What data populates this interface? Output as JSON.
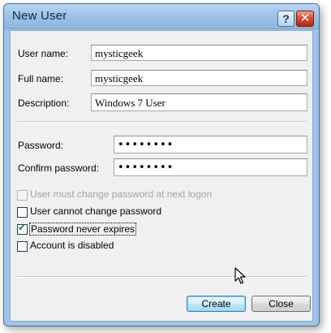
{
  "window": {
    "title": "New User",
    "help_glyph": "?",
    "close_glyph": "✕"
  },
  "fields": {
    "user_name": {
      "label": "User name:",
      "value": "mysticgeek"
    },
    "full_name": {
      "label": "Full name:",
      "value": "mysticgeek"
    },
    "description": {
      "label": "Description:",
      "value": "Windows 7 User"
    },
    "password": {
      "label": "Password:",
      "value": "••••••••"
    },
    "confirm_password": {
      "label": "Confirm password:",
      "value": "••••••••"
    }
  },
  "options": {
    "must_change": {
      "label": "User must change password at next logon",
      "checked": false,
      "enabled": false
    },
    "cannot_change": {
      "label": "User cannot change password",
      "checked": false,
      "enabled": true
    },
    "never_expires": {
      "label": "Password never expires",
      "checked": true,
      "enabled": true
    },
    "disabled": {
      "label": "Account is disabled",
      "checked": false,
      "enabled": true
    }
  },
  "buttons": {
    "create": "Create",
    "close": "Close"
  },
  "icons": {
    "help": "help-icon",
    "close": "close-icon",
    "check": "checkmark-icon",
    "cursor": "mouse-pointer-icon"
  }
}
